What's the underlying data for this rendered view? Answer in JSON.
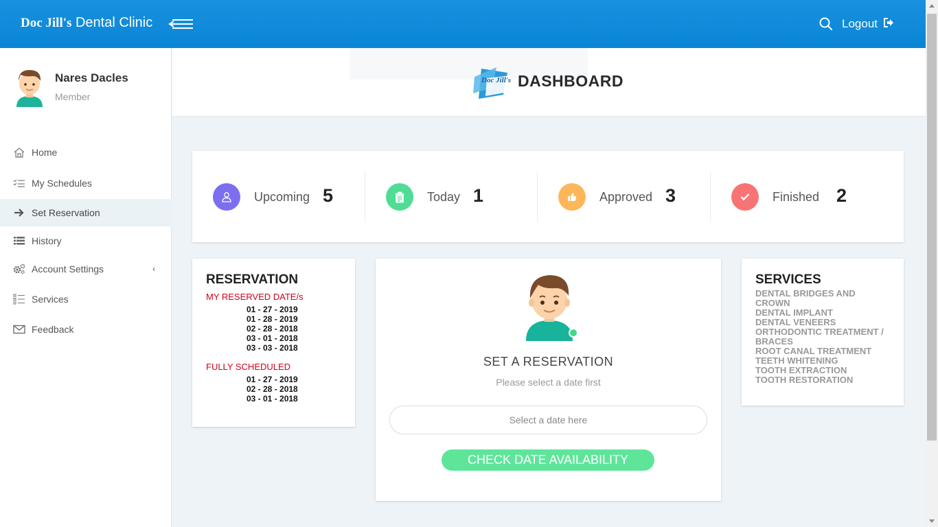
{
  "brand": {
    "name_bold": "Doc Jill's",
    "name_rest": "Dental Clinic"
  },
  "topbar": {
    "logout_label": "Logout"
  },
  "profile": {
    "name": "Nares Dacles",
    "role": "Member"
  },
  "sidebar": {
    "items": [
      {
        "label": "Home",
        "icon": "home-icon"
      },
      {
        "label": "My Schedules",
        "icon": "schedule-list-icon"
      },
      {
        "label": "Set Reservation",
        "icon": "arrow-right-icon",
        "active": true
      },
      {
        "label": "History",
        "icon": "list-icon"
      },
      {
        "label": "Account Settings",
        "icon": "gears-icon",
        "chevron": "‹"
      },
      {
        "label": "Services",
        "icon": "checklist-icon"
      },
      {
        "label": "Feedback",
        "icon": "envelope-icon"
      }
    ]
  },
  "header": {
    "title": "DASHBOARD",
    "logo_text": "Doc Jill's"
  },
  "stats": [
    {
      "label": "Upcoming",
      "value": "5",
      "color": "#7b6ff0",
      "icon": "user-icon"
    },
    {
      "label": "Today",
      "value": "1",
      "color": "#4fdc94",
      "icon": "clipboard-icon"
    },
    {
      "label": "Approved",
      "value": "3",
      "color": "#fdb75a",
      "icon": "thumbs-up-icon"
    },
    {
      "label": "Finished",
      "value": "2",
      "color": "#f87474",
      "icon": "check-icon"
    }
  ],
  "reservation": {
    "title": "RESERVATION",
    "reserved_label": "MY RESERVED DATE/s",
    "reserved_dates": [
      "01 - 27 - 2019",
      "01 - 28 - 2019",
      "02 - 28 - 2018",
      "03 - 01 - 2018",
      "03 - 03 - 2018"
    ],
    "full_label": "FULLY SCHEDULED",
    "full_dates": [
      "01 - 27 - 2019",
      "02 - 28 - 2018",
      "03 - 01 - 2018"
    ]
  },
  "set_reservation": {
    "title": "SET A RESERVATION",
    "subtitle": "Please select a date first",
    "date_placeholder": "Select a date here",
    "button_label": "CHECK DATE AVAILABILITY"
  },
  "services": {
    "title": "SERVICES",
    "items": [
      "DENTAL BRIDGES AND CROWN",
      "DENTAL IMPLANT",
      "DENTAL VENEERS",
      "ORTHODONTIC TREATMENT / BRACES",
      "ROOT CANAL TREATMENT",
      "TEETH WHITENING",
      "TOOTH EXTRACTION",
      "TOOTH RESTORATION"
    ]
  },
  "colors": {
    "topbar": "#0a85d6",
    "accent_green": "#5ee59a",
    "reserved_red": "#d0021b",
    "online_dot": "#3ddc84"
  }
}
